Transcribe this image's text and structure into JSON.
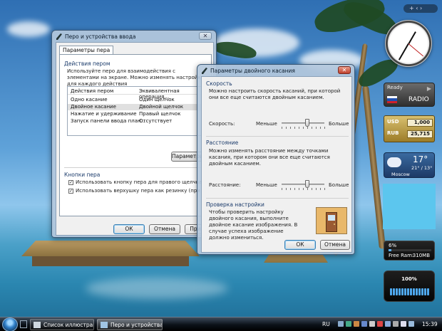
{
  "dialog_main": {
    "title": "Перо и устройства ввода",
    "tab_label": "Параметры пера",
    "group_actions_title": "Действия пером",
    "description": "Используйте перо для взаимодействия с элементами на экране. Можно изменять настройки для каждого действия",
    "list_headers": [
      "Действия пером",
      "Эквивалентная операция..."
    ],
    "list_rows": [
      [
        "Одно касание",
        "Один щелчок"
      ],
      [
        "Двойное касание",
        "Двойной щелчок"
      ],
      [
        "Нажатие и удерживание",
        "Правый щелчок"
      ],
      [
        "Запуск панели ввода план...",
        "Отсутствует"
      ]
    ],
    "settings_button": "Параметры...",
    "group_buttons_title": "Кнопки пера",
    "checkbox_1": "Использовать кнопку пера для правого щелчка",
    "checkbox_2": "Использовать верхушку пера как резинку (при наличии)",
    "ok": "ОК",
    "cancel": "Отмена",
    "apply": "Приме"
  },
  "dialog_double_tap": {
    "title": "Параметры двойного касания",
    "speed_group": "Скорость",
    "speed_desc": "Можно настроить скорость касаний, при которой они все еще считаются двойным касанием.",
    "speed_label": "Скорость:",
    "speed_less": "Меньше",
    "speed_more": "Больше",
    "speed_value": 0.6,
    "distance_group": "Расстояние",
    "distance_desc": "Можно изменять расстояние между точками касания, при котором они все еще считаются двойным касанием.",
    "distance_label": "Расстояние:",
    "distance_less": "Меньше",
    "distance_more": "Больше",
    "distance_value": 0.6,
    "test_group": "Проверка настройки",
    "test_desc": "Чтобы проверить настройку двойного касания, выполните двойное касание изображения. В случае успеха изображение должно измениться.",
    "ok": "ОК",
    "cancel": "Отмена"
  },
  "sidebar": {
    "controls": "+ ‹ ›",
    "radio_status": "Ready",
    "radio_label": "RADIO",
    "usd_label": "USD",
    "usd_value": "1,000",
    "rub_label": "RUB",
    "rub_value": "25,715",
    "temp": "17°",
    "temp_range": "21° / 13°",
    "city": "Moscow",
    "cpu_percent": "6%",
    "free_ram_label": "Free Ram:",
    "free_ram_value": "310MB",
    "battery_percent": "100%",
    "battery_level": 1.0
  },
  "taskbar": {
    "task1": "Список иллюстрац...",
    "task2": "Перо и устройства ...",
    "language": "RU",
    "time": "15:39"
  },
  "colors": {
    "accent": "#3c7fb1",
    "notes": "#5cc6ee"
  }
}
